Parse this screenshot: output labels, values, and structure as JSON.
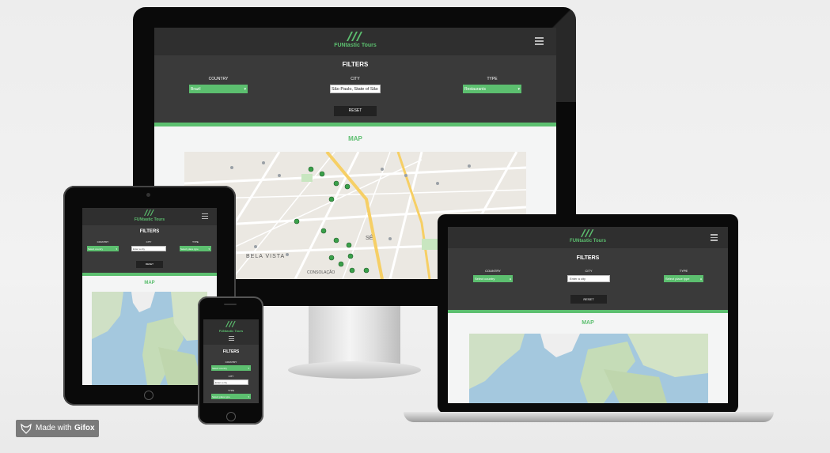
{
  "site": {
    "brand": "FUNtastic Tours",
    "filters_title": "FILTERS",
    "country_label": "COUNTRY",
    "city_label": "CITY",
    "type_label": "TYPE",
    "reset_label": "RESET",
    "map_title": "MAP"
  },
  "desktop": {
    "country_value": "Brazil",
    "city_value": "São Paulo, State of São",
    "type_value": "Restaurants",
    "street_labels": [
      "BELA VISTA",
      "SÉ",
      "CONSOLAÇÃO"
    ]
  },
  "laptop": {
    "country_value": "Select country",
    "city_value": "Enter a city",
    "type_value": "Select place type"
  },
  "tablet": {
    "country_value": "Select country",
    "city_value": "Enter a city",
    "type_value": "Select place type"
  },
  "phone": {
    "country_value": "Select country",
    "city_value": "Enter a city",
    "type_value": "Select place type"
  },
  "badge": {
    "prefix": "Made with",
    "brand": "Gifox"
  },
  "colors": {
    "accent": "#5cbf6f",
    "nav": "#2f2f2f",
    "filters": "#3a3a3a",
    "page": "#f4f5f5"
  }
}
